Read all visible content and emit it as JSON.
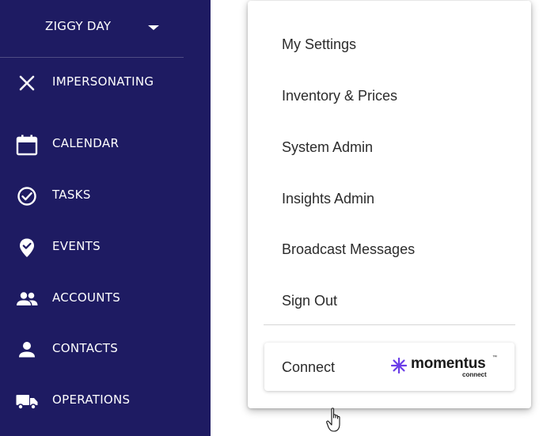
{
  "sidebar": {
    "user_name": "ZIGGY DAY",
    "impersonating_label": "IMPERSONATING",
    "nav": [
      {
        "label": "CALENDAR",
        "icon": "calendar-icon"
      },
      {
        "label": "TASKS",
        "icon": "check-circle-icon"
      },
      {
        "label": "EVENTS",
        "icon": "location-check-icon"
      },
      {
        "label": "ACCOUNTS",
        "icon": "people-icon"
      },
      {
        "label": "CONTACTS",
        "icon": "person-icon"
      },
      {
        "label": "OPERATIONS",
        "icon": "truck-icon"
      }
    ]
  },
  "menu": {
    "items": [
      {
        "label": "My Settings"
      },
      {
        "label": "Inventory & Prices"
      },
      {
        "label": "System Admin"
      },
      {
        "label": "Insights Admin"
      },
      {
        "label": "Broadcast Messages"
      },
      {
        "label": "Sign Out"
      }
    ],
    "connect": {
      "label": "Connect",
      "logo_word": "momentus",
      "logo_sub": "connect",
      "logo_tm": "™"
    }
  },
  "colors": {
    "sidebar_bg": "#1e1b62",
    "logo_accent": "#6a3de8"
  }
}
